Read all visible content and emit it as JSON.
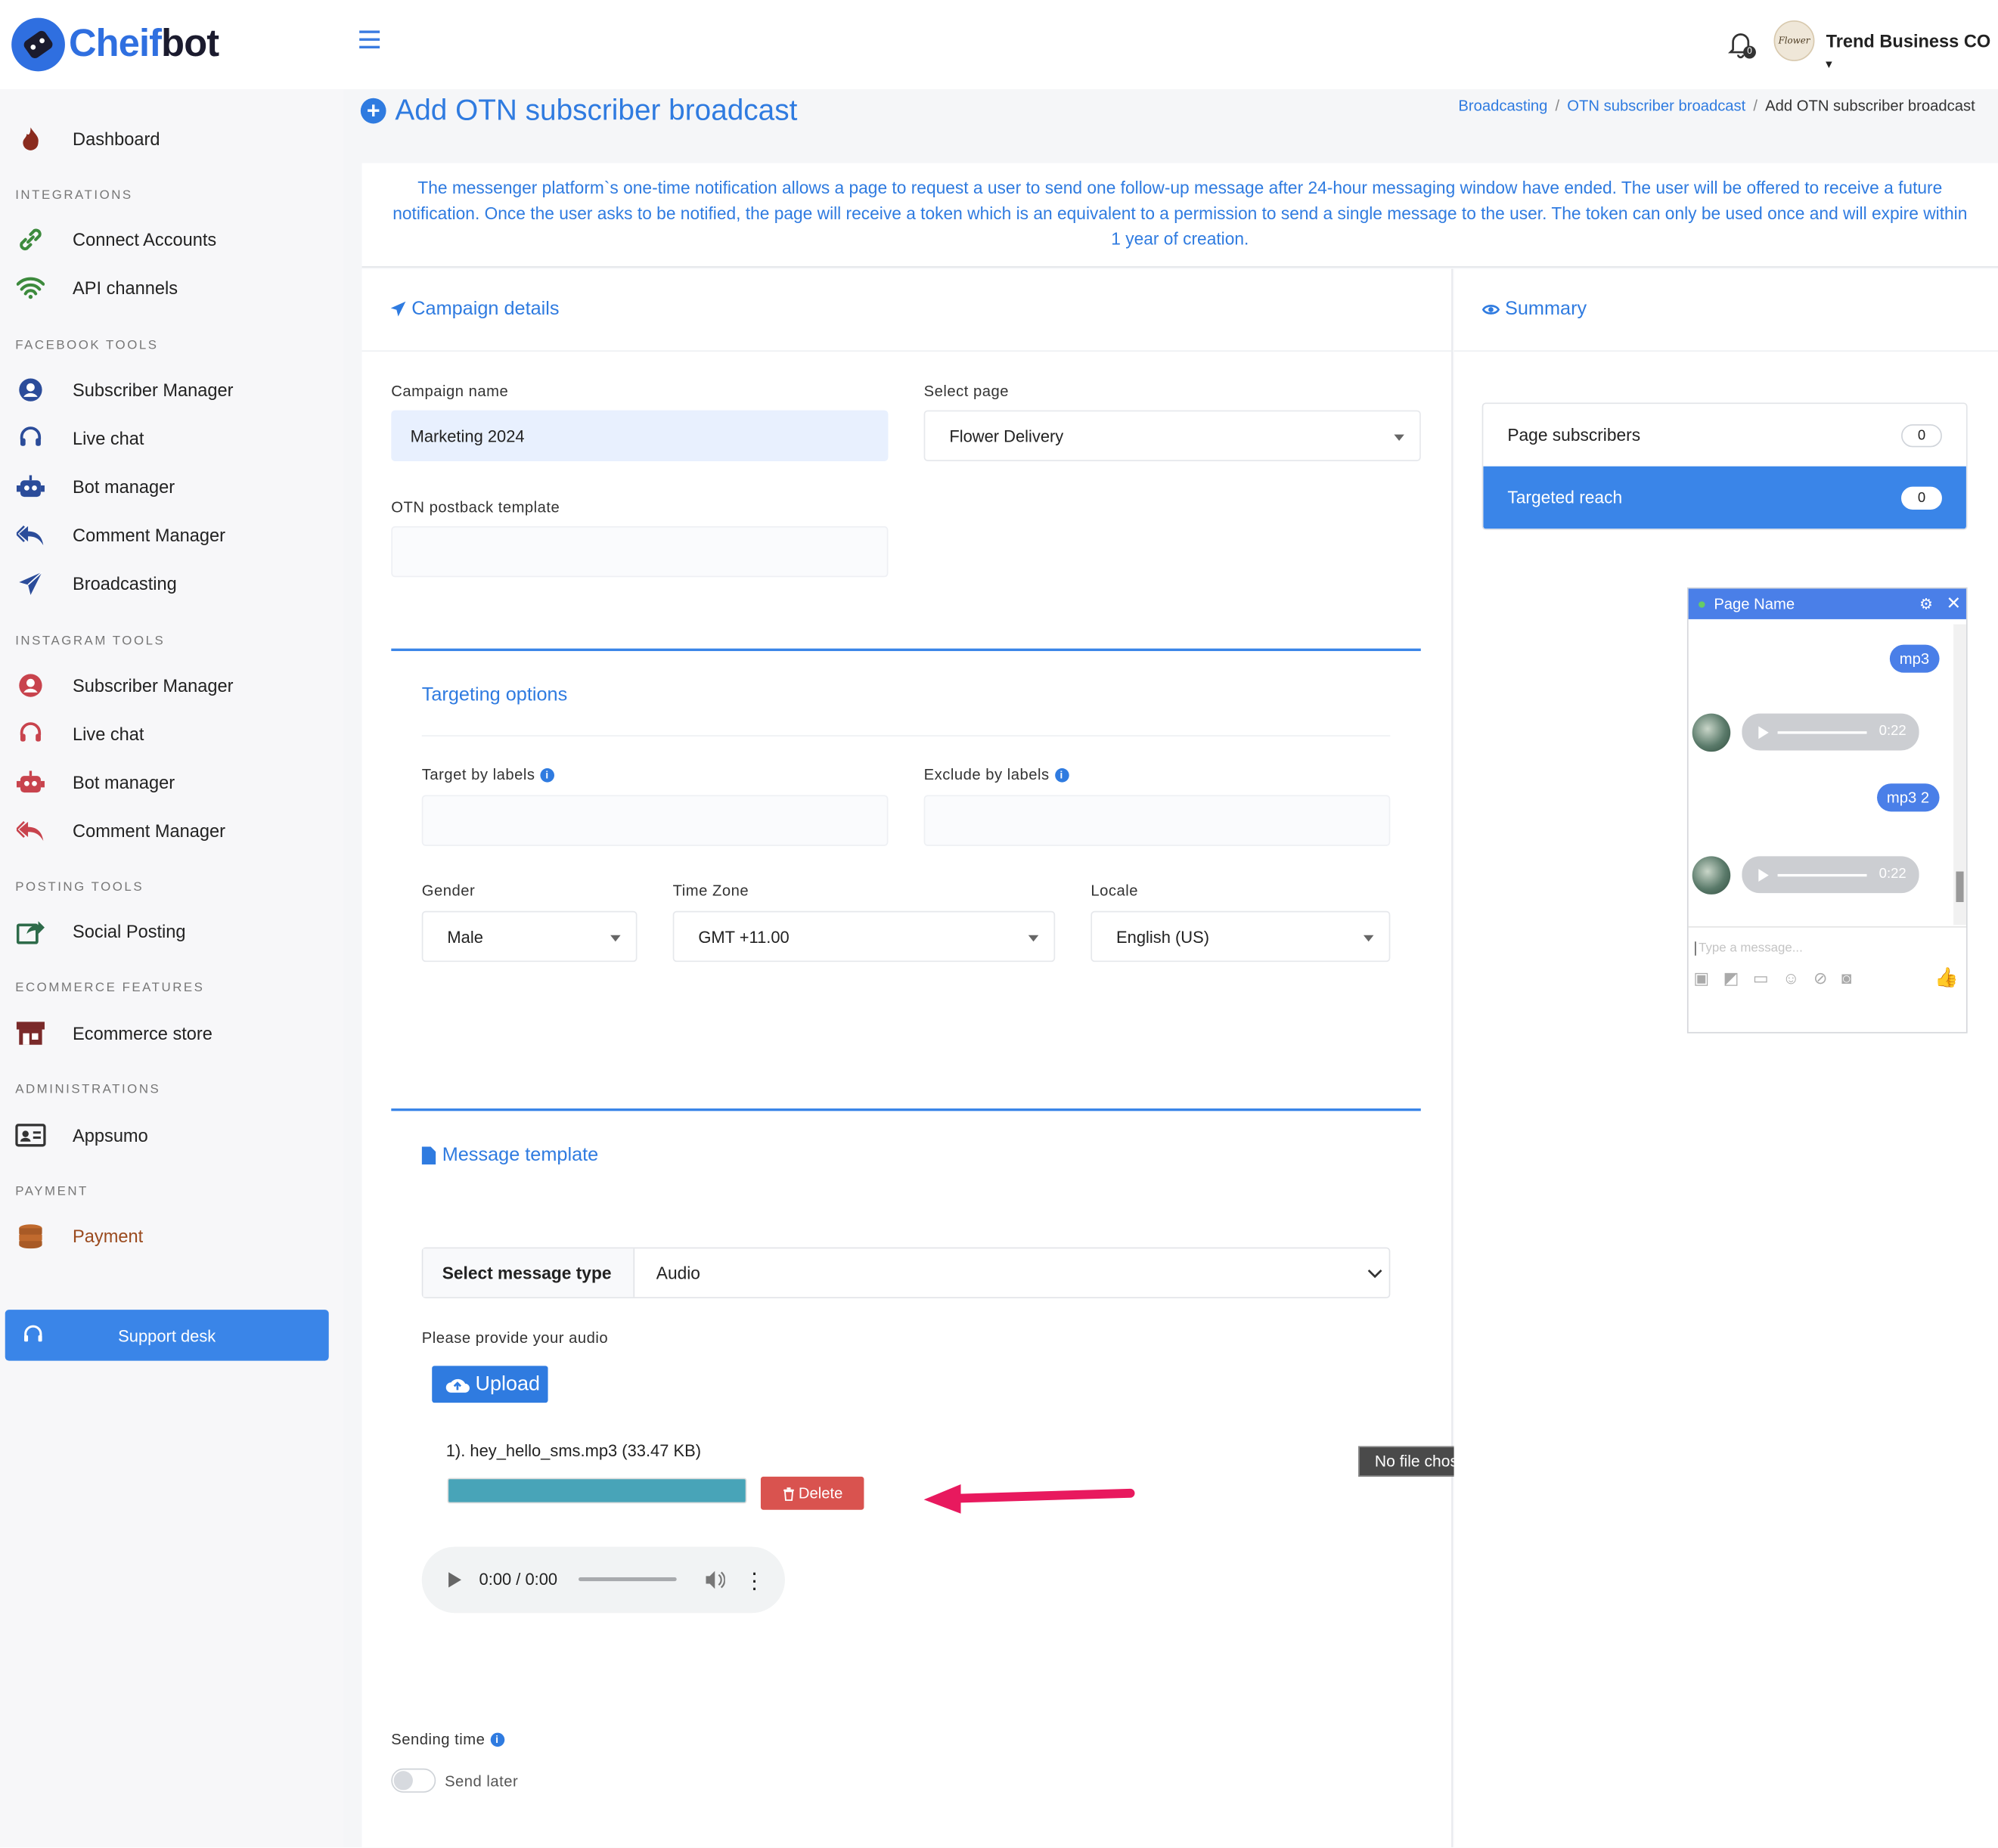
{
  "brand": {
    "name_part1": "Cheif",
    "name_part2": "bot"
  },
  "header": {
    "notification_count": "0",
    "avatar_text": "Flower",
    "company": "Trend Business CO"
  },
  "sidebar": {
    "dashboard": "Dashboard",
    "sections": [
      "INTEGRATIONS",
      "FACEBOOK TOOLS",
      "INSTAGRAM TOOLS",
      "POSTING TOOLS",
      "ECOMMERCE FEATURES",
      "ADMINISTRATIONS",
      "PAYMENT"
    ],
    "integrations": [
      "Connect Accounts",
      "API channels"
    ],
    "facebook": [
      "Subscriber Manager",
      "Live chat",
      "Bot manager",
      "Comment Manager",
      "Broadcasting"
    ],
    "instagram": [
      "Subscriber Manager",
      "Live chat",
      "Bot manager",
      "Comment Manager"
    ],
    "posting": [
      "Social Posting"
    ],
    "ecommerce": [
      "Ecommerce store"
    ],
    "admin": [
      "Appsumo"
    ],
    "payment": [
      "Payment"
    ],
    "support": "Support desk",
    "icons": [
      "flame-icon",
      "link-icon",
      "wifi-icon",
      "user-icon",
      "headset-icon",
      "robot-icon",
      "reply-icon",
      "paper-plane-icon",
      "user-icon",
      "headset-icon",
      "robot-icon",
      "reply-icon",
      "share-icon",
      "store-icon",
      "id-card-icon",
      "coins-icon"
    ]
  },
  "page": {
    "title": "Add OTN subscriber broadcast",
    "breadcrumb": [
      "Broadcasting",
      "OTN subscriber broadcast",
      "Add OTN subscriber broadcast"
    ],
    "info": "The messenger platform`s one-time notification allows a page to request a user to send one follow-up message after 24-hour messaging window have ended. The user will be offered to receive a future notification. Once the user asks to be notified, the page will receive a token which is an equivalent to a permission to send a single message to the user. The token can only be used once and will expire within 1 year of creation."
  },
  "campaign": {
    "header": "Campaign details",
    "name_label": "Campaign name",
    "name_value": "Marketing 2024",
    "page_label": "Select page",
    "page_value": "Flower Delivery",
    "postback_label": "OTN postback template",
    "postback_value": ""
  },
  "targeting": {
    "header": "Targeting options",
    "target_label": "Target by labels",
    "exclude_label": "Exclude by labels",
    "gender_label": "Gender",
    "gender_value": "Male",
    "tz_label": "Time Zone",
    "tz_value": "GMT +11.00",
    "locale_label": "Locale",
    "locale_value": "English (US)"
  },
  "message": {
    "header": "Message template",
    "type_label": "Select message type",
    "type_value": "Audio",
    "audio_prompt": "Please provide your audio",
    "upload": "Upload",
    "file": "1). hey_hello_sms.mp3 (33.47 KB)",
    "delete": "Delete",
    "player_time": "0:00 / 0:00",
    "tooltip": "No file chosen"
  },
  "sending": {
    "label": "Sending time",
    "toggle": "Send later"
  },
  "summary": {
    "header": "Summary",
    "rows": [
      {
        "label": "Page subscribers",
        "value": "0"
      },
      {
        "label": "Targeted reach",
        "value": "0"
      }
    ]
  },
  "preview": {
    "page_name": "Page Name",
    "bubbles": [
      "mp3",
      "mp3 2"
    ],
    "audio_time": "0:22",
    "placeholder": "Type a message..."
  },
  "colors": {
    "accent": "#2f7be0",
    "delete": "#d9534f",
    "progress": "#48a4b8",
    "arrow": "#e8195e"
  }
}
